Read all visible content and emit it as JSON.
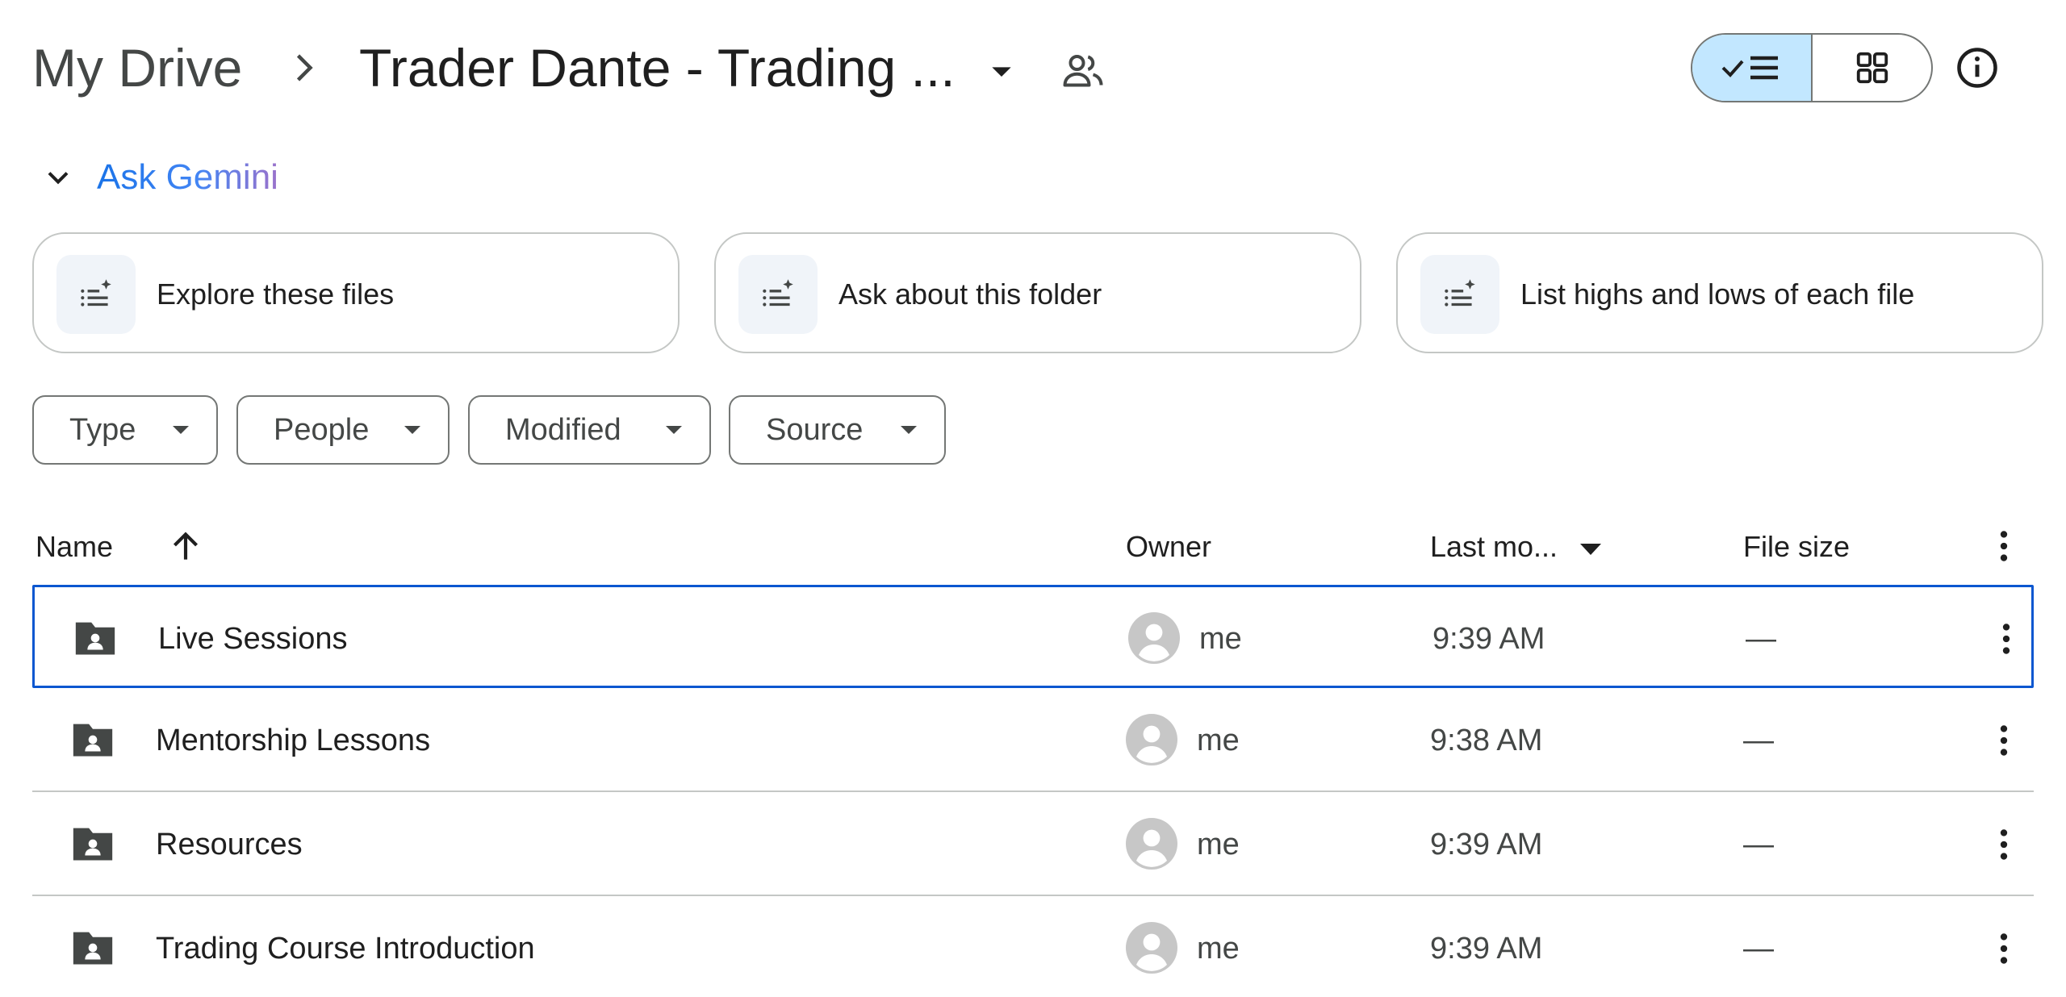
{
  "breadcrumb": {
    "root": "My Drive",
    "current": "Trader Dante - Trading ..."
  },
  "header": {
    "view_modes": [
      "list",
      "grid"
    ],
    "active_view": "list"
  },
  "gemini": {
    "label": "Ask Gemini",
    "suggestions": [
      {
        "label": "Explore these files",
        "icon": "gemini-list-sparkle-icon"
      },
      {
        "label": "Ask about this folder",
        "icon": "gemini-list-sparkle-icon"
      },
      {
        "label": "List highs and lows of each file",
        "icon": "gemini-list-sparkle-icon"
      }
    ]
  },
  "filters": [
    {
      "label": "Type"
    },
    {
      "label": "People"
    },
    {
      "label": "Modified"
    },
    {
      "label": "Source"
    }
  ],
  "table": {
    "columns": {
      "name": "Name",
      "owner": "Owner",
      "last_modified": "Last mo...",
      "file_size": "File size"
    },
    "rows": [
      {
        "name": "Live Sessions",
        "owner": "me",
        "modified": "9:39 AM",
        "size": "—",
        "selected": true
      },
      {
        "name": "Mentorship Lessons",
        "owner": "me",
        "modified": "9:38 AM",
        "size": "—",
        "selected": false
      },
      {
        "name": "Resources",
        "owner": "me",
        "modified": "9:39 AM",
        "size": "—",
        "selected": false
      },
      {
        "name": "Trading Course Introduction",
        "owner": "me",
        "modified": "9:39 AM",
        "size": "—",
        "selected": false
      }
    ]
  },
  "colors": {
    "accent": "#0b57d0",
    "active_toggle": "#c2e7ff",
    "folder": "#444746",
    "avatar": "#c7c7c7"
  }
}
